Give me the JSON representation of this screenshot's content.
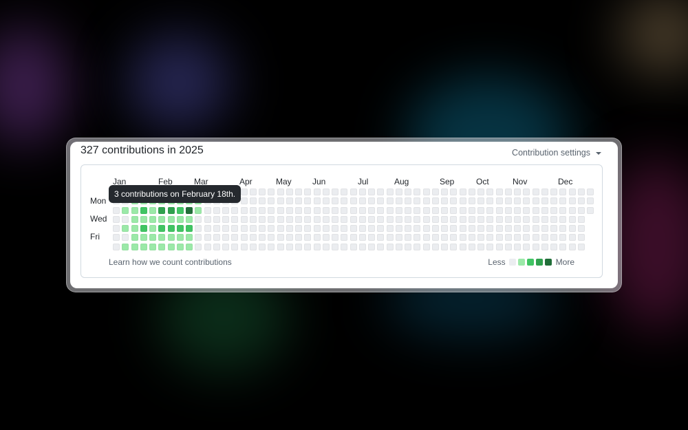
{
  "summary": {
    "title": "327 contributions in 2025"
  },
  "settings": {
    "label": "Contribution settings"
  },
  "months": [
    "Jan",
    "Feb",
    "Mar",
    "Apr",
    "May",
    "Jun",
    "Jul",
    "Aug",
    "Sep",
    "Oct",
    "Nov",
    "Dec"
  ],
  "days": [
    "Mon",
    "Wed",
    "Fri"
  ],
  "tooltip": {
    "text": "3 contributions on February 18th."
  },
  "footer": {
    "learn_link": "Learn how we count contributions"
  },
  "legend": {
    "less": "Less",
    "more": "More"
  },
  "colors": {
    "level0": "#ebedf0",
    "level1": "#9be9a8",
    "level2": "#40c463",
    "level3": "#30a14e",
    "level4": "#216e39"
  },
  "calendar": {
    "weeks": 53,
    "levels": [
      "0000000",
      "0010101",
      "0111111",
      "0121211",
      "0111111",
      "0131211",
      "0131211",
      "0121211",
      "0141211",
      "0110000"
    ]
  }
}
